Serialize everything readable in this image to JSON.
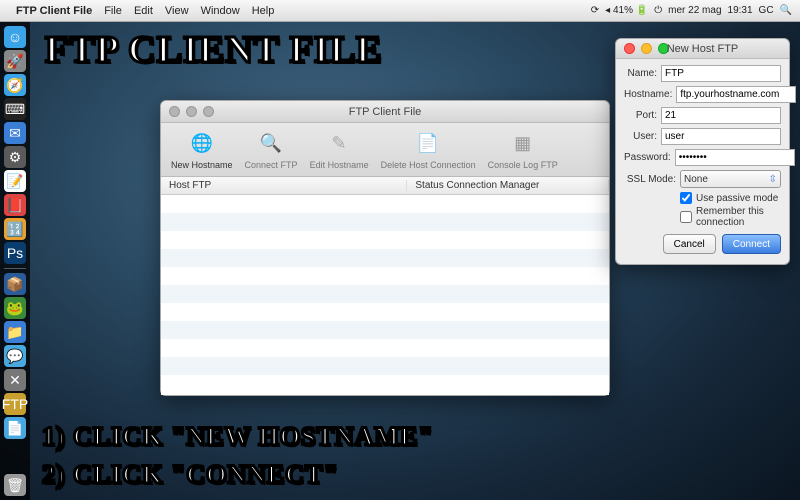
{
  "menubar": {
    "app": "FTP Client File",
    "items": [
      "File",
      "Edit",
      "View",
      "Window",
      "Help"
    ],
    "battery": "41%",
    "date": "mer 22 mag",
    "time": "19:31",
    "user": "GC"
  },
  "dock": {
    "items": [
      "finder",
      "launchpad",
      "safari",
      "terminal",
      "mail",
      "settings",
      "textedit",
      "dictionary",
      "calculator",
      "photoshop"
    ],
    "items2": [
      "box",
      "frog",
      "folder",
      "chat",
      "tools",
      "ftp",
      "docs"
    ],
    "trash": "trash"
  },
  "ftp_window": {
    "title": "FTP Client File",
    "toolbar": [
      {
        "label": "New Hostname",
        "icon": "🌐",
        "active": true
      },
      {
        "label": "Connect FTP",
        "icon": "🔍",
        "active": false
      },
      {
        "label": "Edit Hostname",
        "icon": "✎",
        "active": false
      },
      {
        "label": "Delete Host Connection",
        "icon": "📄",
        "active": false
      },
      {
        "label": "Console Log FTP",
        "icon": "▦",
        "active": false
      }
    ],
    "columns": [
      "Host FTP",
      "Status Connection Manager"
    ]
  },
  "dialog": {
    "title": "New Host FTP",
    "fields": {
      "name_label": "Name:",
      "name_value": "FTP",
      "hostname_label": "Hostname:",
      "hostname_value": "ftp.yourhostname.com",
      "port_label": "Port:",
      "port_value": "21",
      "user_label": "User:",
      "user_value": "user",
      "password_label": "Password:",
      "password_value": "••••••••",
      "ssl_label": "SSL Mode:",
      "ssl_value": "None",
      "passive_label": "Use passive mode",
      "remember_label": "Remember this connection"
    },
    "buttons": {
      "cancel": "Cancel",
      "connect": "Connect"
    }
  },
  "overlay": {
    "title": "FTP Client File",
    "step1": "1) Click \"New Hostname\"",
    "step2": "2) Click \"Connect\""
  }
}
